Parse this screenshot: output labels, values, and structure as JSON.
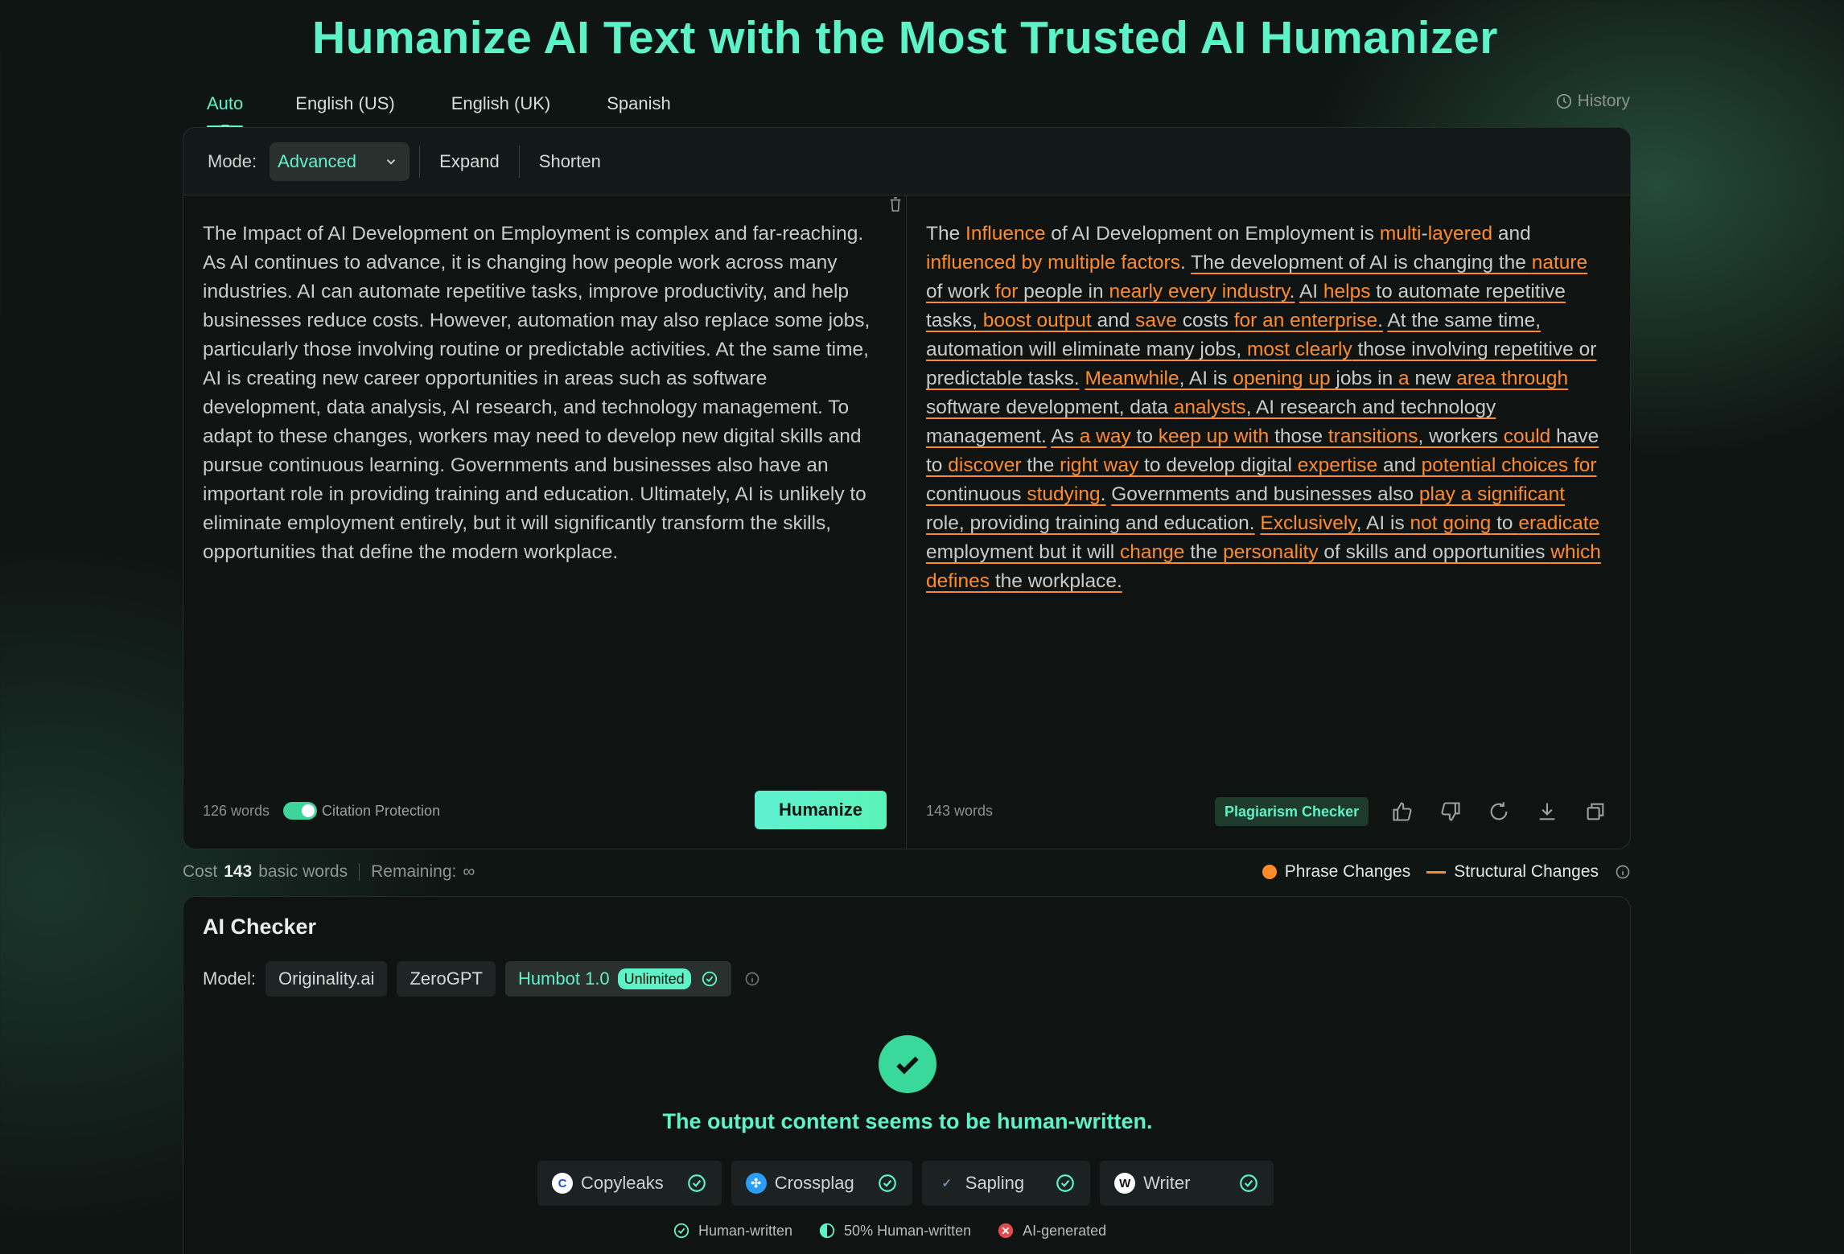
{
  "title": "Humanize AI Text with the Most Trusted AI Humanizer",
  "lang_tabs": [
    "Auto",
    "English (US)",
    "English (UK)",
    "Spanish"
  ],
  "history_label": "History",
  "mode": {
    "label": "Mode:",
    "selected": "Advanced",
    "options": [
      "Expand",
      "Shorten"
    ]
  },
  "input": {
    "text": "The Impact of AI Development on Employment is complex and far-reaching. As AI continues to advance, it is changing how people work across many industries. AI can automate repetitive tasks, improve productivity, and help businesses reduce costs. However, automation may also replace some jobs, particularly those involving routine or predictable activities. At the same time, AI is creating new career opportunities in areas such as software development, data analysis, AI research, and technology management. To adapt to these changes, workers may need to develop new digital skills and pursue continuous learning. Governments and businesses also have an important role in providing training and education. Ultimately, AI is unlikely to eliminate employment entirely, but it will significantly transform the skills, opportunities that define the modern workplace.",
    "word_count": "126 words",
    "citation_label": "Citation Protection",
    "humanize_label": "Humanize"
  },
  "output": {
    "word_count": "143 words",
    "plagiarism_label": "Plagiarism Checker",
    "segments": [
      {
        "t": "The ",
        "c": 0,
        "u": 0
      },
      {
        "t": "Influence",
        "c": 1,
        "u": 0
      },
      {
        "t": " of AI Development on Employment is ",
        "c": 0,
        "u": 0
      },
      {
        "t": "multi",
        "c": 1,
        "u": 0
      },
      {
        "t": "-",
        "c": 0,
        "u": 0
      },
      {
        "t": "layered",
        "c": 1,
        "u": 0
      },
      {
        "t": " and ",
        "c": 0,
        "u": 0
      },
      {
        "t": "influenced by multiple factors",
        "c": 1,
        "u": 0
      },
      {
        "t": ". ",
        "c": 0,
        "u": 0
      },
      {
        "t": "The development of AI is changing the ",
        "c": 0,
        "u": 1
      },
      {
        "t": "nature",
        "c": 1,
        "u": 1
      },
      {
        "t": " of work ",
        "c": 0,
        "u": 1
      },
      {
        "t": "for",
        "c": 1,
        "u": 1
      },
      {
        "t": " people in ",
        "c": 0,
        "u": 1
      },
      {
        "t": "nearly every industry",
        "c": 1,
        "u": 1
      },
      {
        "t": ".",
        "c": 0,
        "u": 1
      },
      {
        "t": " ",
        "c": 0,
        "u": 0
      },
      {
        "t": "AI ",
        "c": 0,
        "u": 1
      },
      {
        "t": "helps",
        "c": 1,
        "u": 1
      },
      {
        "t": " to automate repetitive tasks, ",
        "c": 0,
        "u": 1
      },
      {
        "t": "boost output",
        "c": 1,
        "u": 1
      },
      {
        "t": " and ",
        "c": 0,
        "u": 1
      },
      {
        "t": "save",
        "c": 1,
        "u": 1
      },
      {
        "t": " costs ",
        "c": 0,
        "u": 1
      },
      {
        "t": "for an enterprise",
        "c": 1,
        "u": 1
      },
      {
        "t": ".",
        "c": 0,
        "u": 1
      },
      {
        "t": " ",
        "c": 0,
        "u": 0
      },
      {
        "t": "At the same time, automation will eliminate many jobs, ",
        "c": 0,
        "u": 1
      },
      {
        "t": "most clearly",
        "c": 1,
        "u": 1
      },
      {
        "t": " those involving repetitive or predictable tasks.",
        "c": 0,
        "u": 1
      },
      {
        "t": " ",
        "c": 0,
        "u": 0
      },
      {
        "t": "Meanwhile",
        "c": 1,
        "u": 1
      },
      {
        "t": ", AI is ",
        "c": 0,
        "u": 1
      },
      {
        "t": "opening up",
        "c": 1,
        "u": 1
      },
      {
        "t": " jobs in ",
        "c": 0,
        "u": 1
      },
      {
        "t": "a",
        "c": 1,
        "u": 1
      },
      {
        "t": " new ",
        "c": 0,
        "u": 1
      },
      {
        "t": "area through",
        "c": 1,
        "u": 1
      },
      {
        "t": " software development, data ",
        "c": 0,
        "u": 1
      },
      {
        "t": "analysts",
        "c": 1,
        "u": 1
      },
      {
        "t": ", AI research and technology management.",
        "c": 0,
        "u": 1
      },
      {
        "t": " ",
        "c": 0,
        "u": 0
      },
      {
        "t": "As ",
        "c": 0,
        "u": 1
      },
      {
        "t": "a way",
        "c": 1,
        "u": 1
      },
      {
        "t": " to ",
        "c": 0,
        "u": 1
      },
      {
        "t": "keep up with",
        "c": 1,
        "u": 1
      },
      {
        "t": " those ",
        "c": 0,
        "u": 1
      },
      {
        "t": "transitions",
        "c": 1,
        "u": 1
      },
      {
        "t": ", workers ",
        "c": 0,
        "u": 1
      },
      {
        "t": "could",
        "c": 1,
        "u": 1
      },
      {
        "t": " have to ",
        "c": 0,
        "u": 1
      },
      {
        "t": "discover",
        "c": 1,
        "u": 1
      },
      {
        "t": " the ",
        "c": 0,
        "u": 1
      },
      {
        "t": "right way",
        "c": 1,
        "u": 1
      },
      {
        "t": " to develop digital ",
        "c": 0,
        "u": 1
      },
      {
        "t": "expertise",
        "c": 1,
        "u": 1
      },
      {
        "t": " and ",
        "c": 0,
        "u": 1
      },
      {
        "t": "potential choices for",
        "c": 1,
        "u": 1
      },
      {
        "t": " continuous ",
        "c": 0,
        "u": 1
      },
      {
        "t": "studying",
        "c": 1,
        "u": 1
      },
      {
        "t": ".",
        "c": 0,
        "u": 1
      },
      {
        "t": " ",
        "c": 0,
        "u": 0
      },
      {
        "t": "Governments and businesses also ",
        "c": 0,
        "u": 1
      },
      {
        "t": "play a significant",
        "c": 1,
        "u": 1
      },
      {
        "t": " role, providing training and education.",
        "c": 0,
        "u": 1
      },
      {
        "t": " ",
        "c": 0,
        "u": 0
      },
      {
        "t": "Exclusively",
        "c": 1,
        "u": 1
      },
      {
        "t": ", AI is ",
        "c": 0,
        "u": 1
      },
      {
        "t": "not going",
        "c": 1,
        "u": 1
      },
      {
        "t": " to ",
        "c": 0,
        "u": 1
      },
      {
        "t": "eradicate",
        "c": 1,
        "u": 1
      },
      {
        "t": " employment but it will ",
        "c": 0,
        "u": 1
      },
      {
        "t": "change",
        "c": 1,
        "u": 1
      },
      {
        "t": " the ",
        "c": 0,
        "u": 1
      },
      {
        "t": "personality",
        "c": 1,
        "u": 1
      },
      {
        "t": " of skills and opportunities ",
        "c": 0,
        "u": 1
      },
      {
        "t": "which defines",
        "c": 1,
        "u": 1
      },
      {
        "t": " the workplace.",
        "c": 0,
        "u": 1
      }
    ]
  },
  "cost": {
    "prefix": "Cost",
    "value": "143",
    "suffix": "basic words",
    "remaining_label": "Remaining:",
    "remaining_value": "∞"
  },
  "legend": {
    "phrase": "Phrase Changes",
    "structural": "Structural Changes"
  },
  "checker": {
    "title": "AI Checker",
    "model_label": "Model:",
    "models": [
      "Originality.ai",
      "ZeroGPT"
    ],
    "active_model": "Humbot 1.0",
    "active_badge": "Unlimited",
    "result": "The output content seems to be human-written.",
    "detectors": [
      "Copyleaks",
      "Crossplag",
      "Sapling",
      "Writer"
    ],
    "key": {
      "human": "Human-written",
      "half": "50% Human-written",
      "ai": "AI-generated"
    }
  },
  "colors": {
    "accent": "#5ef2c7",
    "change": "#ff8b2b",
    "ai_red": "#e5484d"
  }
}
